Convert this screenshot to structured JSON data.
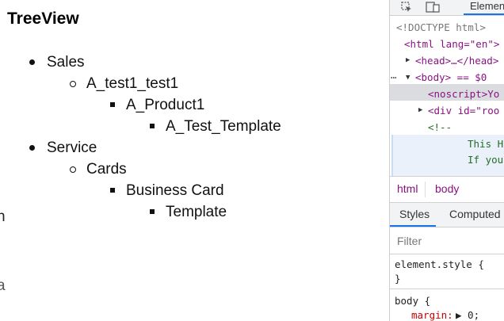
{
  "gutter": {
    "fragments": [
      "n",
      ";",
      "a"
    ]
  },
  "page": {
    "title": "TreeView",
    "tree": [
      {
        "label": "Sales"
      },
      {
        "label": "A_test1_test1"
      },
      {
        "label": "A_Product1"
      },
      {
        "label": "A_Test_Template"
      },
      {
        "label": "Service"
      },
      {
        "label": "Cards"
      },
      {
        "label": "Business Card"
      },
      {
        "label": "Template"
      }
    ]
  },
  "devtools": {
    "tab_elements": "Elemen",
    "dom": {
      "doctype": "<!DOCTYPE html>",
      "html_open": "<html lang=\"en\">",
      "head": "<head>…</head>",
      "body": "<body> == $0",
      "noscript": "<noscript>Yo",
      "div_root": "<div id=\"roo",
      "comment_open": "<!--",
      "comment_line1": "This H",
      "comment_line2": "If you"
    },
    "breadcrumbs": [
      "html",
      "body"
    ],
    "styles_tabs": [
      "Styles",
      "Computed"
    ],
    "filter_placeholder": "Filter",
    "element_style": {
      "selector": "element.style {",
      "close": "}"
    },
    "body_rule": {
      "selector": "body {",
      "prop": "margin:",
      "value": "▶ 0;"
    }
  }
}
